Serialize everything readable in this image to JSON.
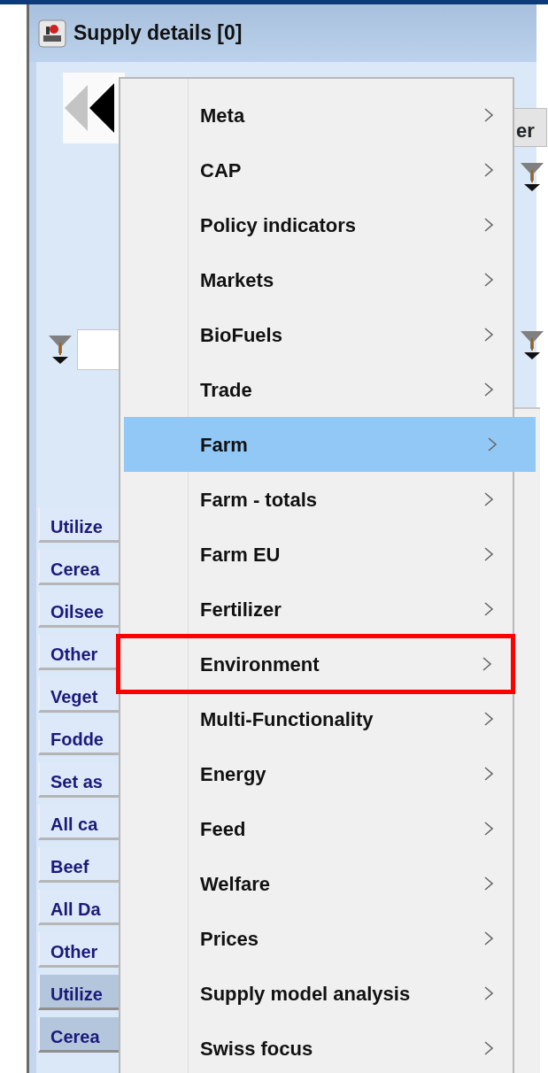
{
  "window": {
    "title": "Supply details [0]"
  },
  "right_tab": "er",
  "rows": [
    {
      "label": "Utilize",
      "selected": false
    },
    {
      "label": "Cerea",
      "selected": false
    },
    {
      "label": "Oilsee",
      "selected": false
    },
    {
      "label": "Other",
      "selected": false
    },
    {
      "label": "Veget",
      "selected": false
    },
    {
      "label": "Fodde",
      "selected": false
    },
    {
      "label": "Set as",
      "selected": false
    },
    {
      "label": "All ca",
      "selected": false
    },
    {
      "label": "Beef",
      "selected": false
    },
    {
      "label": "All Da",
      "selected": false
    },
    {
      "label": "Other",
      "selected": false
    },
    {
      "label": "Utilize",
      "selected": true
    },
    {
      "label": "Cerea",
      "selected": true
    }
  ],
  "menu": [
    {
      "label": "Meta",
      "selected": false,
      "annotated": false
    },
    {
      "label": "CAP",
      "selected": false,
      "annotated": false
    },
    {
      "label": "Policy indicators",
      "selected": false,
      "annotated": false
    },
    {
      "label": "Markets",
      "selected": false,
      "annotated": false
    },
    {
      "label": "BioFuels",
      "selected": false,
      "annotated": false
    },
    {
      "label": "Trade",
      "selected": false,
      "annotated": false
    },
    {
      "label": "Farm",
      "selected": true,
      "annotated": false
    },
    {
      "label": "Farm - totals",
      "selected": false,
      "annotated": false
    },
    {
      "label": "Farm EU",
      "selected": false,
      "annotated": false
    },
    {
      "label": "Fertilizer",
      "selected": false,
      "annotated": false
    },
    {
      "label": "Environment",
      "selected": false,
      "annotated": true
    },
    {
      "label": "Multi-Functionality",
      "selected": false,
      "annotated": false
    },
    {
      "label": "Energy",
      "selected": false,
      "annotated": false
    },
    {
      "label": "Feed",
      "selected": false,
      "annotated": false
    },
    {
      "label": "Welfare",
      "selected": false,
      "annotated": false
    },
    {
      "label": "Prices",
      "selected": false,
      "annotated": false
    },
    {
      "label": "Supply model analysis",
      "selected": false,
      "annotated": false
    },
    {
      "label": "Swiss focus",
      "selected": false,
      "annotated": false
    }
  ]
}
